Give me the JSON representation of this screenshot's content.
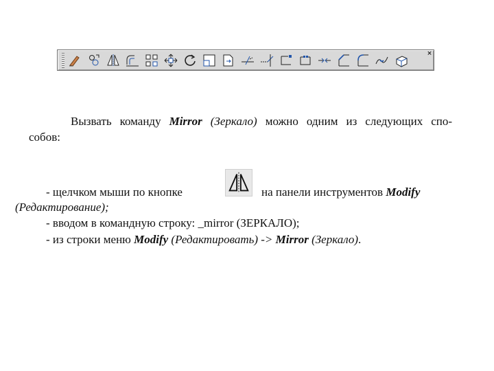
{
  "toolbar": {
    "close_glyph": "×",
    "buttons": [
      {
        "icon": "erase-icon"
      },
      {
        "icon": "copy-icon"
      },
      {
        "icon": "mirror-icon"
      },
      {
        "icon": "offset-icon"
      },
      {
        "icon": "array-icon"
      },
      {
        "icon": "move-icon"
      },
      {
        "icon": "rotate-icon"
      },
      {
        "icon": "scale-icon"
      },
      {
        "icon": "stretch-icon"
      },
      {
        "icon": "trim-icon"
      },
      {
        "icon": "extend-icon"
      },
      {
        "icon": "break-at-point-icon"
      },
      {
        "icon": "break-icon"
      },
      {
        "icon": "join-icon"
      },
      {
        "icon": "chamfer-icon"
      },
      {
        "icon": "fillet-icon"
      },
      {
        "icon": "blend-curves-icon"
      },
      {
        "icon": "explode-icon"
      }
    ]
  },
  "text": {
    "p1_line1_start": "Вызвать команду ",
    "p1_cmd": "Mirror",
    "p1_cmd_ru": " (Зеркало)",
    "p1_line1_end": " можно одним из следующих спо-",
    "p1_line2": "собов:",
    "b1_start": "- щелчком мыши по кнопке",
    "b1_end_a": "на панели инструментов ",
    "b1_panel": "Modify",
    "b1_line2": "(Редактирование);",
    "b2": "- вводом в командную строку: _mirror (ЗЕРКАЛО);",
    "b3_start": "- из строки меню ",
    "b3_menu": "Modify",
    "b3_menu_ru": " (Редактировать) -> ",
    "b3_cmd": "Mirror",
    "b3_cmd_ru": " (Зеркало)",
    "b3_end": "."
  }
}
